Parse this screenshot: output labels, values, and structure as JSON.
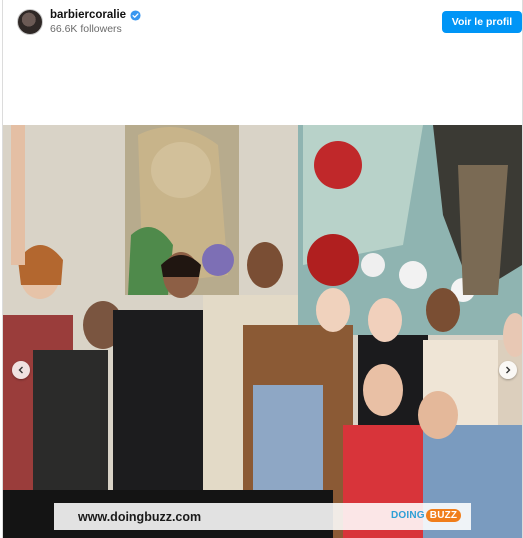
{
  "header": {
    "username": "barbiercoralie",
    "followers": "66.6K followers",
    "profile_button": "Voir le profil"
  },
  "photo": {
    "watermark_url": "www.doingbuzz.com",
    "watermark_logo_left": "DOING",
    "watermark_logo_right": "BUZZ"
  },
  "colors": {
    "accent": "#0095f6",
    "verified": "#3897f0"
  },
  "icons": {
    "verified": "verified-badge-icon",
    "prev": "chevron-left-icon",
    "next": "chevron-right-icon"
  }
}
